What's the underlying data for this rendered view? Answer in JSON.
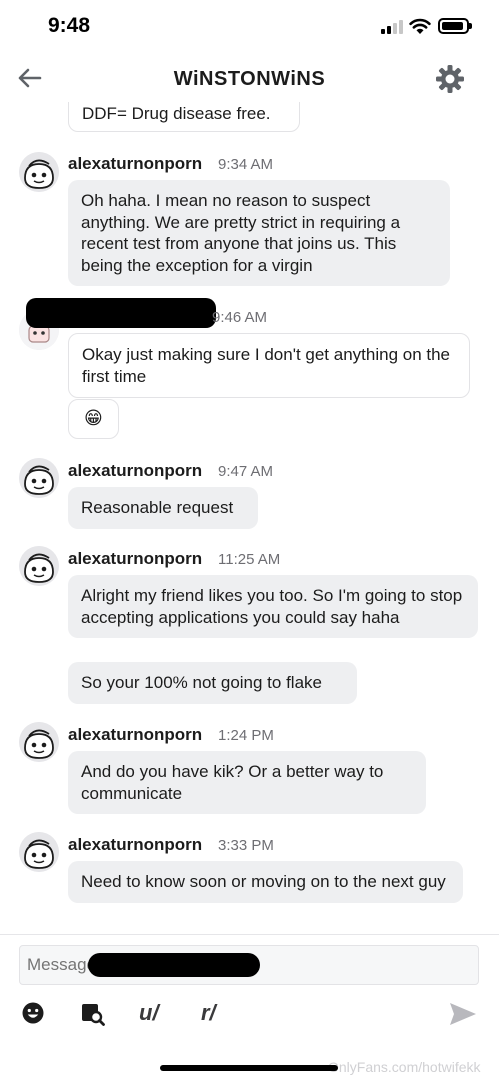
{
  "status_bar": {
    "time": "9:48"
  },
  "header": {
    "title": "WiNSTONWiNS"
  },
  "messages": [
    {
      "text": "DDF= Drug disease free."
    },
    {
      "user": "alexaturnonporn",
      "time": "9:34 AM",
      "text": "Oh haha. I mean no reason to suspect anything. We are pretty strict in requiring a recent test from anyone that joins us. This being the exception for a virgin"
    },
    {
      "time": "9:46 AM",
      "text": "Okay just making sure I don't get anything on the first time",
      "reaction": "😁"
    },
    {
      "user": "alexaturnonporn",
      "time": "9:47 AM",
      "text": "Reasonable request"
    },
    {
      "user": "alexaturnonporn",
      "time": "11:25 AM",
      "text": "Alright my friend likes you too. So I'm going to stop accepting applications you could say haha",
      "text2": "So your 100% not going to flake"
    },
    {
      "user": "alexaturnonporn",
      "time": "1:24 PM",
      "text": "And do you have kik? Or a better way to communicate"
    },
    {
      "user": "alexaturnonporn",
      "time": "3:33 PM",
      "text": "Need to know soon or moving on to the next guy"
    }
  ],
  "composer": {
    "placeholder": "Message",
    "tools": {
      "user_label": "u/",
      "subreddit_label": "r/"
    }
  },
  "watermark": "OnlyFans.com/hotwifekk"
}
